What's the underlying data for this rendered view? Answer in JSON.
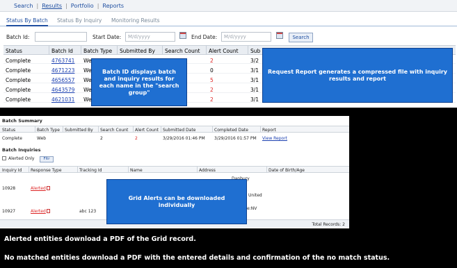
{
  "nav": {
    "items": [
      {
        "label": "Search"
      },
      {
        "label": "Results"
      },
      {
        "label": "Portfolio"
      },
      {
        "label": "Reports"
      }
    ],
    "separator": "|"
  },
  "subtabs": [
    {
      "label": "Status By Batch"
    },
    {
      "label": "Status By Inquiry"
    },
    {
      "label": "Monitoring Results"
    }
  ],
  "filters": {
    "batch_id_label": "Batch Id:",
    "start_date_label": "Start Date:",
    "end_date_label": "End Date:",
    "date_placeholder": "M/d/yyyy",
    "search_label": "Search"
  },
  "batch_grid": {
    "columns": [
      "Status",
      "Batch Id",
      "Batch Type",
      "Submitted By",
      "Search Count",
      "Alert Count",
      "Sub"
    ],
    "rows": [
      {
        "status": "Complete",
        "batch_id": "4763741",
        "type": "Web",
        "alert": "2",
        "sub": "3/2"
      },
      {
        "status": "Complete",
        "batch_id": "4671223",
        "type": "We",
        "alert": "0",
        "sub": "3/1"
      },
      {
        "status": "Complete",
        "batch_id": "4656557",
        "type": "We",
        "alert": "5",
        "sub": "3/1"
      },
      {
        "status": "Complete",
        "batch_id": "4643579",
        "type": "We",
        "alert": "2",
        "sub": "3/1"
      },
      {
        "status": "Complete",
        "batch_id": "4621031",
        "type": "We",
        "alert": "2",
        "sub": "3/1"
      }
    ]
  },
  "callouts": {
    "batch_id": "Batch ID displays batch and inquiry results for each name in the \"search group\"",
    "request_report": "Request Report generates a compressed file with inquiry results and report",
    "grid_alerts": "Grid Alerts can be downloaded individually"
  },
  "batch_summary": {
    "title": "Batch Summary",
    "columns": [
      "Status",
      "Batch Type",
      "Submitted By",
      "Search Count",
      "Alert Count",
      "Submitted Date",
      "Completed Date",
      "Report"
    ],
    "row": {
      "status": "Complete",
      "type": "Web",
      "search_count": "2",
      "alert_count": "2",
      "submitted": "3/29/2016 01:46 PM",
      "completed": "3/29/2016 01:57 PM",
      "report": "View Report"
    }
  },
  "batch_inquiries": {
    "title": "Batch Inquiries",
    "alerted_only": "Alerted Only",
    "filter_label": "Fltr",
    "columns": [
      "Inquiry Id",
      "Response Type",
      "Tracking Id",
      "Name",
      "Address",
      "Date of Birth/Age"
    ],
    "rows": [
      {
        "inquiry_id": "10928",
        "response": "Alerted",
        "tracking": "",
        "address": "United"
      },
      {
        "inquiry_id": "10927",
        "response": "Alerted",
        "tracking": "abc 123",
        "address": "e:NV"
      }
    ],
    "partial_address": "Danbury",
    "total_records": "Total Records: 2"
  },
  "captions": {
    "line1": "Alerted entities download a PDF of the Grid record.",
    "line2": "No matched entities download a PDF with the entered details and confirmation of the no match status."
  }
}
